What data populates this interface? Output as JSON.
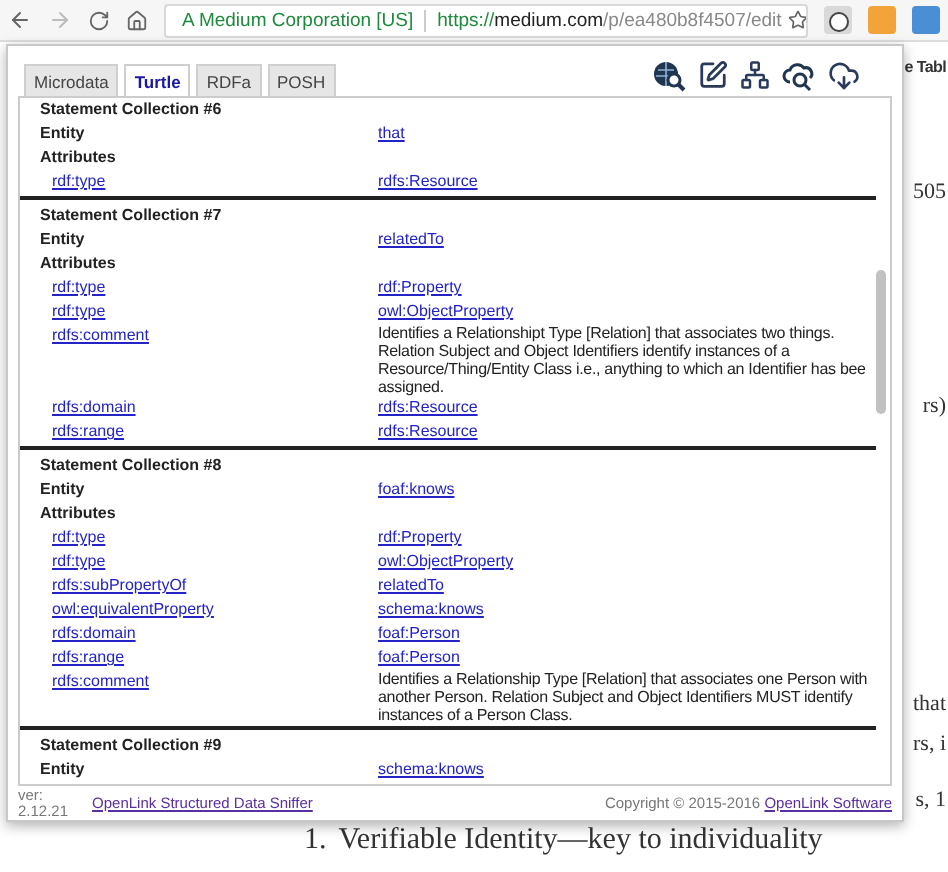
{
  "browser": {
    "site_identity": "A Medium Corporation [US]",
    "url": {
      "scheme": "https://",
      "host": "medium.com",
      "path": "/p/ea480b8f4507/edit"
    }
  },
  "page": {
    "fragments": [
      {
        "kind": "toolbar",
        "text": "e Tabl"
      },
      {
        "kind": "body",
        "text": "505"
      },
      {
        "kind": "body",
        "text": "rs)"
      },
      {
        "kind": "body",
        "text": "that"
      },
      {
        "kind": "body",
        "text": "rs, i"
      },
      {
        "kind": "body",
        "text": "s, 1"
      }
    ],
    "list_item": {
      "number": "1.",
      "text": "Verifiable Identity—key to individuality"
    }
  },
  "popup": {
    "tabs": [
      {
        "label": "Microdata",
        "selected": false
      },
      {
        "label": "Turtle",
        "selected": true
      },
      {
        "label": "RDFa",
        "selected": false
      },
      {
        "label": "POSH",
        "selected": false
      }
    ],
    "collections": [
      {
        "title": "Statement Collection #6",
        "entity_label": "Entity",
        "entity": "that",
        "attributes_label": "Attributes",
        "attributes": [
          {
            "property": "rdf:type",
            "kind": "link",
            "value": [
              "rdfs:Resource"
            ]
          }
        ]
      },
      {
        "title": "Statement Collection #7",
        "entity_label": "Entity",
        "entity": "relatedTo",
        "attributes_label": "Attributes",
        "attributes": [
          {
            "property": "rdf:type",
            "kind": "link",
            "value": [
              "rdf:Property"
            ]
          },
          {
            "property": "rdf:type",
            "kind": "link",
            "value": [
              "owl:ObjectProperty"
            ]
          },
          {
            "property": "rdfs:comment",
            "kind": "text",
            "value": [
              "Identifies a Relationshipt Type [Relation] that associates two things.",
              "Relation Subject and Object Identifiers identify instances of a",
              "Resource/Thing/Entity Class i.e., anything to which an Identifier has bee",
              "assigned."
            ]
          },
          {
            "property": "rdfs:domain",
            "kind": "link",
            "value": [
              "rdfs:Resource"
            ]
          },
          {
            "property": "rdfs:range",
            "kind": "link",
            "value": [
              "rdfs:Resource"
            ]
          }
        ]
      },
      {
        "title": "Statement Collection #8",
        "entity_label": "Entity",
        "entity": "foaf:knows",
        "attributes_label": "Attributes",
        "attributes": [
          {
            "property": "rdf:type",
            "kind": "link",
            "value": [
              "rdf:Property"
            ]
          },
          {
            "property": "rdf:type",
            "kind": "link",
            "value": [
              "owl:ObjectProperty"
            ]
          },
          {
            "property": "rdfs:subPropertyOf",
            "kind": "link",
            "value": [
              "relatedTo"
            ]
          },
          {
            "property": "owl:equivalentProperty",
            "kind": "link",
            "value": [
              "schema:knows"
            ]
          },
          {
            "property": "rdfs:domain",
            "kind": "link",
            "value": [
              "foaf:Person"
            ]
          },
          {
            "property": "rdfs:range",
            "kind": "link",
            "value": [
              "foaf:Person"
            ]
          },
          {
            "property": "rdfs:comment",
            "kind": "text",
            "value": [
              "Identifies a Relationship Type [Relation] that associates one Person with",
              "another Person. Relation Subject and Object Identifiers MUST identify",
              "instances of a Person Class."
            ]
          }
        ]
      },
      {
        "title": "Statement Collection #9",
        "entity_label": "Entity",
        "entity": "schema:knows"
      }
    ],
    "footer": {
      "version_label": "ver:",
      "version": "2.12.21",
      "product_link": "OpenLink Structured Data Sniffer",
      "copyright": "Copyright © 2015-2016",
      "company_link": "OpenLink Software"
    }
  }
}
